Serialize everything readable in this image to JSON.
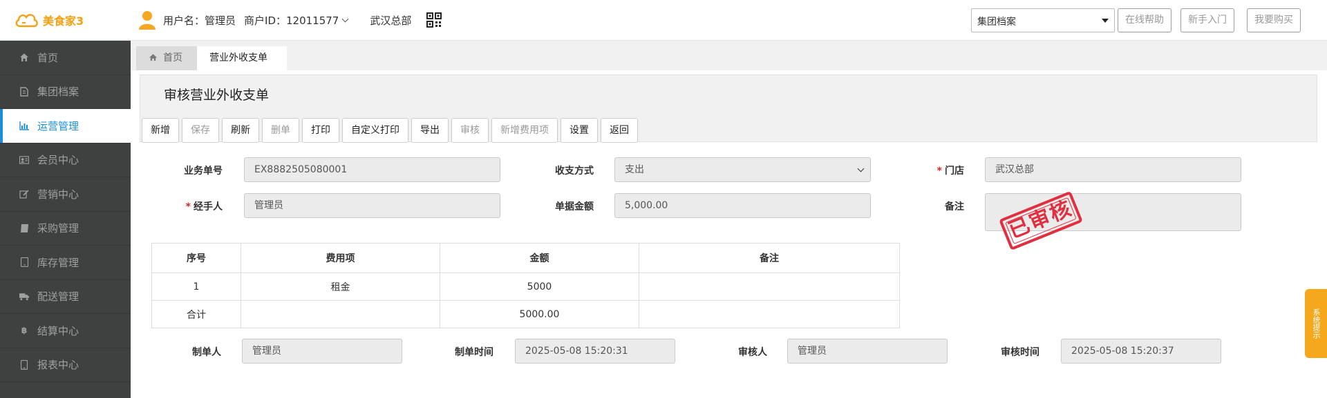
{
  "app": {
    "logo_text": "美食家3"
  },
  "header": {
    "username": "用户名：管理员",
    "merchant_id": "商户ID：12011577",
    "store": "武汉总部",
    "archive_select": "集团档案",
    "buttons": [
      "在线帮助",
      "新手入门",
      "我要购买"
    ]
  },
  "sidebar": {
    "items": [
      {
        "label": "首页",
        "icon": "home-icon"
      },
      {
        "label": "集团档案",
        "icon": "file-icon"
      },
      {
        "label": "运营管理",
        "icon": "bar-chart-icon",
        "active": true
      },
      {
        "label": "会员中心",
        "icon": "id-card-icon"
      },
      {
        "label": "营销中心",
        "icon": "edit-icon"
      },
      {
        "label": "采购管理",
        "icon": "book-icon"
      },
      {
        "label": "库存管理",
        "icon": "tablet-icon"
      },
      {
        "label": "配送管理",
        "icon": "truck-icon"
      },
      {
        "label": "结算中心",
        "icon": "bitcoin-icon"
      },
      {
        "label": "报表中心",
        "icon": "phone-icon"
      }
    ]
  },
  "tabs": {
    "home": "首页",
    "current": "营业外收支单"
  },
  "page": {
    "title": "审核营业外收支单"
  },
  "toolbar": {
    "buttons": [
      {
        "label": "新增",
        "disabled": false
      },
      {
        "label": "保存",
        "disabled": true
      },
      {
        "label": "刷新",
        "disabled": false
      },
      {
        "label": "删单",
        "disabled": true
      },
      {
        "label": "打印",
        "disabled": false
      },
      {
        "label": "自定义打印",
        "disabled": false
      },
      {
        "label": "导出",
        "disabled": false
      },
      {
        "label": "审核",
        "disabled": true
      },
      {
        "label": "新增费用项",
        "disabled": true
      },
      {
        "label": "设置",
        "disabled": false
      },
      {
        "label": "返回",
        "disabled": false
      }
    ]
  },
  "form": {
    "doc_no_label": "业务单号",
    "doc_no": "EX8882505080001",
    "pay_method_label": "收支方式",
    "pay_method": "支出",
    "store_label": "门店",
    "store": "武汉总部",
    "handler_label": "经手人",
    "handler": "管理员",
    "amount_label": "单据金额",
    "amount": "5,000.00",
    "remark_label": "备注",
    "stamp": "已审核"
  },
  "table": {
    "headers": [
      "序号",
      "费用项",
      "金额",
      "备注"
    ],
    "rows": [
      [
        "1",
        "租金",
        "5000",
        ""
      ]
    ],
    "total": {
      "label": "合计",
      "amount": "5000.00"
    }
  },
  "footer": {
    "creator_label": "制单人",
    "creator": "管理员",
    "created_label": "制单时间",
    "created": "2025-05-08 15:20:31",
    "auditor_label": "审核人",
    "auditor": "管理员",
    "audited_label": "审核时间",
    "audited": "2025-05-08 15:20:37"
  },
  "side_float": "系统提示",
  "colors": {
    "accent": "#1a8fd8",
    "sidebar": "#3e4140",
    "brand": "#f5a011",
    "stamp": "#e03040",
    "notice": "#f6a81c"
  }
}
